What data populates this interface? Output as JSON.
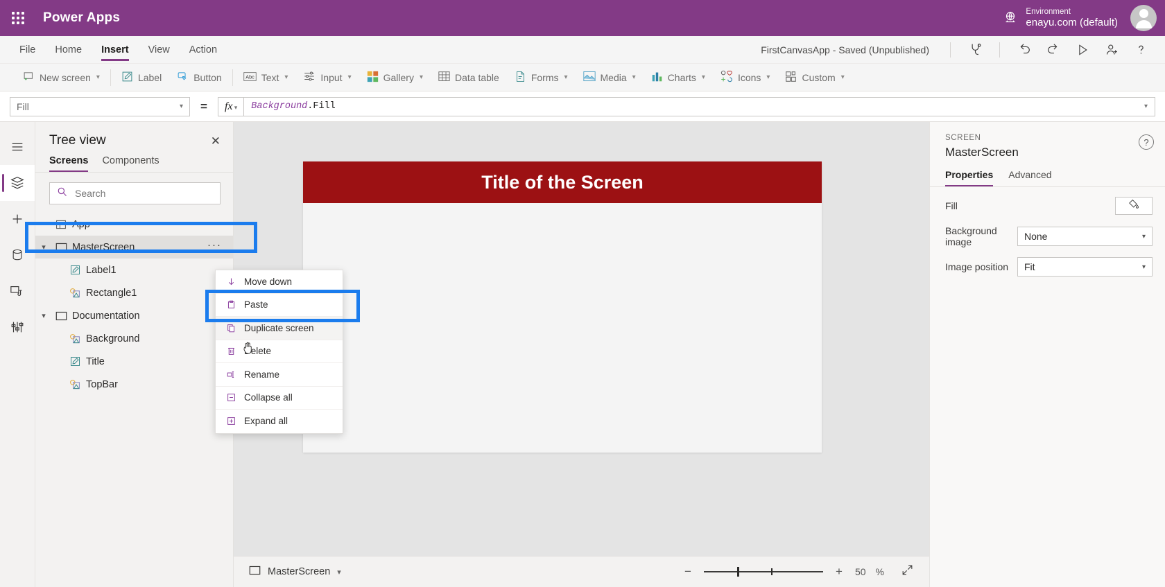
{
  "topbar": {
    "waffle_icon": "app-launcher-icon",
    "brand": "Power Apps",
    "globe_icon": "globe-icon",
    "environment_label": "Environment",
    "environment_value": "enayu.com (default)",
    "avatar": "user-avatar"
  },
  "menubar": {
    "items": [
      {
        "label": "File",
        "active": false
      },
      {
        "label": "Home",
        "active": false
      },
      {
        "label": "Insert",
        "active": true
      },
      {
        "label": "View",
        "active": false
      },
      {
        "label": "Action",
        "active": false
      }
    ],
    "save_state": "FirstCanvasApp - Saved (Unpublished)",
    "icons": [
      "checker-icon",
      "undo-icon",
      "redo-icon",
      "play-icon",
      "share-icon",
      "help-icon"
    ]
  },
  "ribbon": {
    "items": [
      {
        "label": "New screen",
        "icon": "new-screen-icon",
        "caret": true
      },
      {
        "label": "Label",
        "icon": "label-icon",
        "caret": false
      },
      {
        "label": "Button",
        "icon": "button-icon",
        "caret": false
      },
      {
        "label": "Text",
        "icon": "text-icon",
        "caret": true
      },
      {
        "label": "Input",
        "icon": "input-icon",
        "caret": true
      },
      {
        "label": "Gallery",
        "icon": "gallery-icon",
        "caret": true
      },
      {
        "label": "Data table",
        "icon": "data-table-icon",
        "caret": false
      },
      {
        "label": "Forms",
        "icon": "forms-icon",
        "caret": true
      },
      {
        "label": "Media",
        "icon": "media-icon",
        "caret": true
      },
      {
        "label": "Charts",
        "icon": "charts-icon",
        "caret": true
      },
      {
        "label": "Icons",
        "icon": "icons-icon",
        "caret": true
      },
      {
        "label": "Custom",
        "icon": "custom-icon",
        "caret": true
      }
    ]
  },
  "formulabar": {
    "property": "Fill",
    "equals": "=",
    "fx_label": "fx",
    "formula_object": "Background",
    "formula_property": ".Fill"
  },
  "rail": {
    "items": [
      {
        "name": "hamburger-icon",
        "active": false
      },
      {
        "name": "tree-view-icon",
        "active": true
      },
      {
        "name": "insert-icon",
        "active": false
      },
      {
        "name": "data-icon",
        "active": false
      },
      {
        "name": "media-icon",
        "active": false
      },
      {
        "name": "variables-icon",
        "active": false
      }
    ]
  },
  "treeview": {
    "title": "Tree view",
    "close_icon": "close-icon",
    "tabs": [
      {
        "label": "Screens",
        "active": true
      },
      {
        "label": "Components",
        "active": false
      }
    ],
    "search": {
      "placeholder": "Search",
      "value": "",
      "icon": "search-icon"
    },
    "nodes": [
      {
        "label": "App",
        "icon": "app-icon",
        "depth": 0,
        "expandable": false,
        "selected": false
      },
      {
        "label": "MasterScreen",
        "icon": "screen-icon",
        "depth": 0,
        "expandable": true,
        "selected": true,
        "ellipsis": "···"
      },
      {
        "label": "Label1",
        "icon": "label-control-icon",
        "depth": 1,
        "expandable": false,
        "selected": false
      },
      {
        "label": "Rectangle1",
        "icon": "shape-control-icon",
        "depth": 1,
        "expandable": false,
        "selected": false
      },
      {
        "label": "Documentation",
        "icon": "screen-icon",
        "depth": 0,
        "expandable": true,
        "selected": false
      },
      {
        "label": "Background",
        "icon": "shape-control-icon",
        "depth": 1,
        "expandable": false,
        "selected": false
      },
      {
        "label": "Title",
        "icon": "label-control-icon",
        "depth": 1,
        "expandable": false,
        "selected": false
      },
      {
        "label": "TopBar",
        "icon": "shape-control-icon",
        "depth": 1,
        "expandable": false,
        "selected": false
      }
    ]
  },
  "context_menu": {
    "items": [
      {
        "label": "Move down",
        "icon": "move-down-icon",
        "highlighted": false
      },
      {
        "label": "Paste",
        "icon": "paste-icon",
        "highlighted": false
      },
      {
        "label": "Duplicate screen",
        "icon": "duplicate-icon",
        "highlighted": true
      },
      {
        "label": "Delete",
        "icon": "delete-icon",
        "highlighted": false
      },
      {
        "label": "Rename",
        "icon": "rename-icon",
        "highlighted": false
      },
      {
        "label": "Collapse all",
        "icon": "collapse-all-icon",
        "highlighted": false
      },
      {
        "label": "Expand all",
        "icon": "expand-all-icon",
        "highlighted": false
      }
    ]
  },
  "canvas": {
    "screen_title": "Title of the Screen",
    "title_bar_color": "#9c1113",
    "screen_bg": "#f4f4f4",
    "canvas_bg": "#e4e4e4"
  },
  "statusbar": {
    "screen_name": "MasterScreen",
    "screen_icon": "screen-icon",
    "caret_icon": "chevron-down-icon",
    "zoom_out": "−",
    "zoom_in": "+",
    "zoom_value": "50",
    "zoom_unit": "%",
    "fit_icon": "fit-screen-icon"
  },
  "properties": {
    "kind": "SCREEN",
    "name": "MasterScreen",
    "help_icon": "help-icon",
    "tabs": [
      {
        "label": "Properties",
        "active": true
      },
      {
        "label": "Advanced",
        "active": false
      }
    ],
    "rows": [
      {
        "label": "Fill",
        "type": "swatch",
        "value": "",
        "icon": "color-fill-icon"
      },
      {
        "label": "Background image",
        "type": "select",
        "value": "None"
      },
      {
        "label": "Image position",
        "type": "select",
        "value": "Fit"
      }
    ]
  },
  "highlight_color": "#1b7ced"
}
